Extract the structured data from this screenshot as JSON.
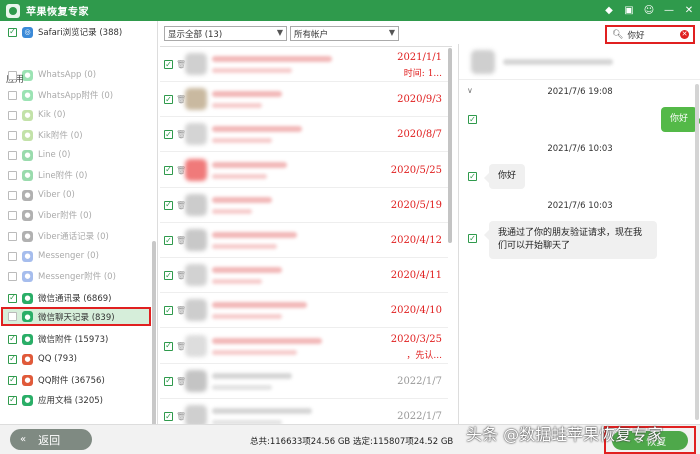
{
  "app": {
    "title": "苹果恢复专家"
  },
  "titlebar_icons": [
    "diamond-icon",
    "chat-icon",
    "feedback-icon",
    "minimize-icon",
    "close-icon"
  ],
  "sidebar": {
    "top_item": {
      "label": "Safari浏览记录 (388)",
      "checked": true
    },
    "section_label": "应用",
    "items": [
      {
        "label": "WhatsApp (0)",
        "checked": false,
        "dim": true,
        "icon": "whatsapp-icon",
        "color": "#25c35a"
      },
      {
        "label": "WhatsApp附件 (0)",
        "checked": false,
        "dim": true,
        "icon": "whatsapp-attach-icon",
        "color": "#25c35a"
      },
      {
        "label": "Kik (0)",
        "checked": false,
        "dim": true,
        "icon": "kik-icon",
        "color": "#7bc043"
      },
      {
        "label": "Kik附件 (0)",
        "checked": false,
        "dim": true,
        "icon": "kik-attach-icon",
        "color": "#7bc043"
      },
      {
        "label": "Line (0)",
        "checked": false,
        "dim": true,
        "icon": "line-icon",
        "color": "#22b14c"
      },
      {
        "label": "Line附件 (0)",
        "checked": false,
        "dim": true,
        "icon": "line-attach-icon",
        "color": "#22b14c"
      },
      {
        "label": "Viber (0)",
        "checked": false,
        "dim": true,
        "icon": "viber-icon",
        "color": "#555555"
      },
      {
        "label": "Viber附件 (0)",
        "checked": false,
        "dim": true,
        "icon": "viber-attach-icon",
        "color": "#555555"
      },
      {
        "label": "Viber通话记录 (0)",
        "checked": false,
        "dim": true,
        "icon": "viber-call-icon",
        "color": "#555555"
      },
      {
        "label": "Messenger (0)",
        "checked": false,
        "dim": true,
        "icon": "messenger-icon",
        "color": "#3b6fd8"
      },
      {
        "label": "Messenger附件 (0)",
        "checked": false,
        "dim": true,
        "icon": "messenger-attach-icon",
        "color": "#3b6fd8"
      },
      {
        "label": "微信通讯录 (6869)",
        "checked": true,
        "dim": false,
        "icon": "wechat-contacts-icon",
        "color": "#2aae67"
      },
      {
        "label": "微信聊天记录 (839)",
        "checked": false,
        "dim": false,
        "icon": "wechat-chat-icon",
        "color": "#2aae67",
        "selected": true
      },
      {
        "label": "微信附件 (15973)",
        "checked": true,
        "dim": false,
        "icon": "wechat-attach-icon",
        "color": "#2aae67"
      },
      {
        "label": "QQ (793)",
        "checked": true,
        "dim": false,
        "icon": "qq-icon",
        "color": "#e05a3a"
      },
      {
        "label": "QQ附件 (36756)",
        "checked": true,
        "dim": false,
        "icon": "qq-attach-icon",
        "color": "#e05a3a"
      },
      {
        "label": "应用文档 (3205)",
        "checked": true,
        "dim": false,
        "icon": "app-docs-icon",
        "color": "#2aae67"
      }
    ]
  },
  "filters": {
    "show": "显示全部 (13)",
    "account": "所有帐户"
  },
  "search": {
    "value": "你好",
    "placeholder": ""
  },
  "conversations": [
    {
      "date": "2021/1/1",
      "sub": "时间: 1...",
      "red": true,
      "avatar": "#d0d0d0"
    },
    {
      "date": "2020/9/3",
      "sub": "",
      "red": true,
      "avatar": "#c9b9a0"
    },
    {
      "date": "2020/8/7",
      "sub": "",
      "red": true,
      "avatar": "#d4d4d4"
    },
    {
      "date": "2020/5/25",
      "sub": "",
      "red": true,
      "avatar": "#f07a7a"
    },
    {
      "date": "2020/5/19",
      "sub": "",
      "red": true,
      "avatar": "#cccccc"
    },
    {
      "date": "2020/4/12",
      "sub": "",
      "red": true,
      "avatar": "#c8c8c8"
    },
    {
      "date": "2020/4/11",
      "sub": "",
      "red": true,
      "avatar": "#d2d2d2"
    },
    {
      "date": "2020/4/10",
      "sub": "",
      "red": true,
      "avatar": "#cdcdcd"
    },
    {
      "date": "2020/3/25",
      "sub": "，先认...",
      "red": true,
      "avatar": "#dddddd"
    },
    {
      "date": "2022/1/7",
      "sub": "",
      "red": false,
      "avatar": "#c4c4c4"
    },
    {
      "date": "2022/1/7",
      "sub": "",
      "red": false,
      "avatar": "#cfcfcf"
    }
  ],
  "chat": {
    "messages": [
      {
        "time": "2021/7/6 19:08",
        "text": "你好",
        "dir": "out"
      },
      {
        "time": "2021/7/6 10:03",
        "text": "你好",
        "dir": "in"
      },
      {
        "time": "2021/7/6 10:03",
        "text": "我通过了你的朋友验证请求，现在我们可以开始聊天了",
        "dir": "in"
      }
    ]
  },
  "bottom": {
    "back_label": "返回",
    "totals": "总共:116633项24.56 GB 选定:115807项24.52 GB",
    "recover_label": "恢复"
  },
  "watermark": "头条 @数据蛙苹果恢复专家"
}
